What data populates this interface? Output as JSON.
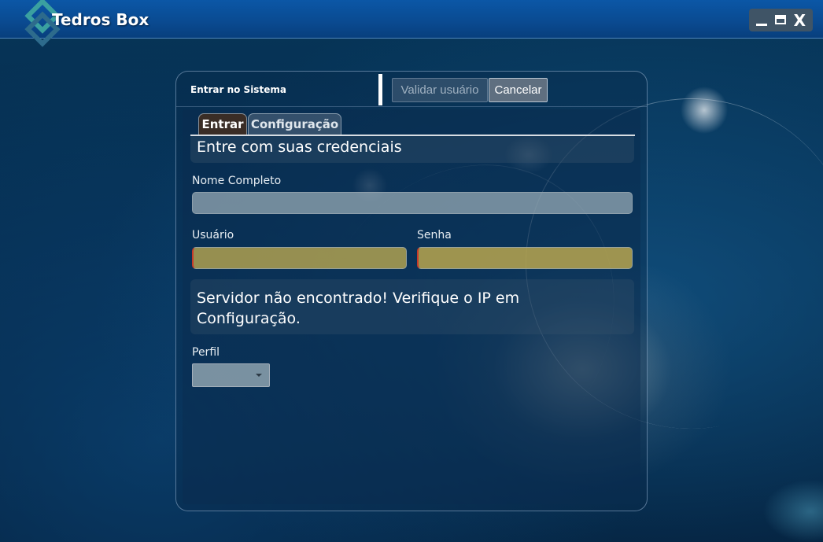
{
  "app": {
    "title": "Tedros Box",
    "window_controls": {
      "minimize": "_",
      "maximize": "▭",
      "close": "X"
    }
  },
  "dialog": {
    "title": "Entrar no Sistema",
    "buttons": {
      "validate": "Validar usuário",
      "cancel": "Cancelar"
    },
    "tabs": [
      {
        "label": "Entrar",
        "active": true
      },
      {
        "label": "Configuração",
        "active": false
      }
    ],
    "heading": "Entre com suas credenciais",
    "fields": {
      "full_name": {
        "label": "Nome Completo",
        "value": ""
      },
      "username": {
        "label": "Usuário",
        "value": ""
      },
      "password": {
        "label": "Senha",
        "value": ""
      }
    },
    "message": "Servidor não encontrado! Verifique o IP em Configuração.",
    "profile": {
      "label": "Perfil",
      "selected": ""
    }
  },
  "colors": {
    "titlebar": "#0a4b92",
    "active_tab": "#3a2d26",
    "error_field": "#c3ac4e",
    "error_border": "#c83a2a"
  }
}
